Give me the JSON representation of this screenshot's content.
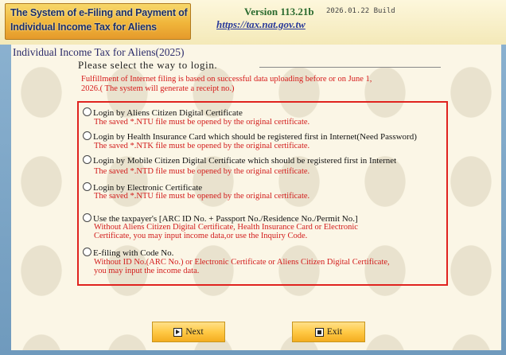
{
  "header": {
    "logo_line1": "The System of e-Filing and Payment of",
    "logo_line2": "Individual Income Tax for Aliens",
    "version": "Version 113.21b",
    "build": "2026.01.22 Build",
    "url": "https://tax.nat.gov.tw"
  },
  "page": {
    "title": "Individual Income Tax for Aliens(2025)",
    "prompt": "Please select the way to login.",
    "notice_line1": "Fulfillment of Internet filing is based on successful data uploading before or on June 1,",
    "notice_line2": "2026.( The system will generate a receipt no.)"
  },
  "options": [
    {
      "label": "Login by Aliens Citizen Digital Certificate",
      "sub1": "The saved *.NTU file must be opened by the original certificate.",
      "sub2": ""
    },
    {
      "label": "Login by Health Insurance Card which should be registered first in Internet(Need Password)",
      "sub1": "The saved *.NTK file must be opened by the original certificate.",
      "sub2": ""
    },
    {
      "label": "Login by Mobile Citizen Digital Certificate which should be registered first in Internet",
      "sub1": "The saved *.NTD file must be opened by the original certificate.",
      "sub2": ""
    },
    {
      "label": "Login by Electronic Certificate",
      "sub1": "The saved *.NTU file must be opened by the original certificate.",
      "sub2": ""
    },
    {
      "label": "Use the taxpayer's [ARC ID No. + Passport No./Residence No./Permit No.]",
      "sub1": "Without Aliens Citizen Digital Certificate, Health Insurance Card or Electronic",
      "sub2": "Certificate, you may input income data,or use the Inquiry Code."
    },
    {
      "label": "E-filing with Code No.",
      "sub1": "Without ID No.(ARC No.) or Electronic Certificate or Aliens Citizen Digital Certificate,",
      "sub2": "you may input the income data."
    }
  ],
  "buttons": {
    "next": "Next",
    "exit": "Exit"
  },
  "icons": {
    "next": "play-triangle-icon",
    "exit": "stop-square-icon"
  },
  "colors": {
    "accent_red": "#e0231f",
    "notice_red": "#d61a1a",
    "button_gold": "#ffc946",
    "version_green": "#2a6a2e"
  }
}
